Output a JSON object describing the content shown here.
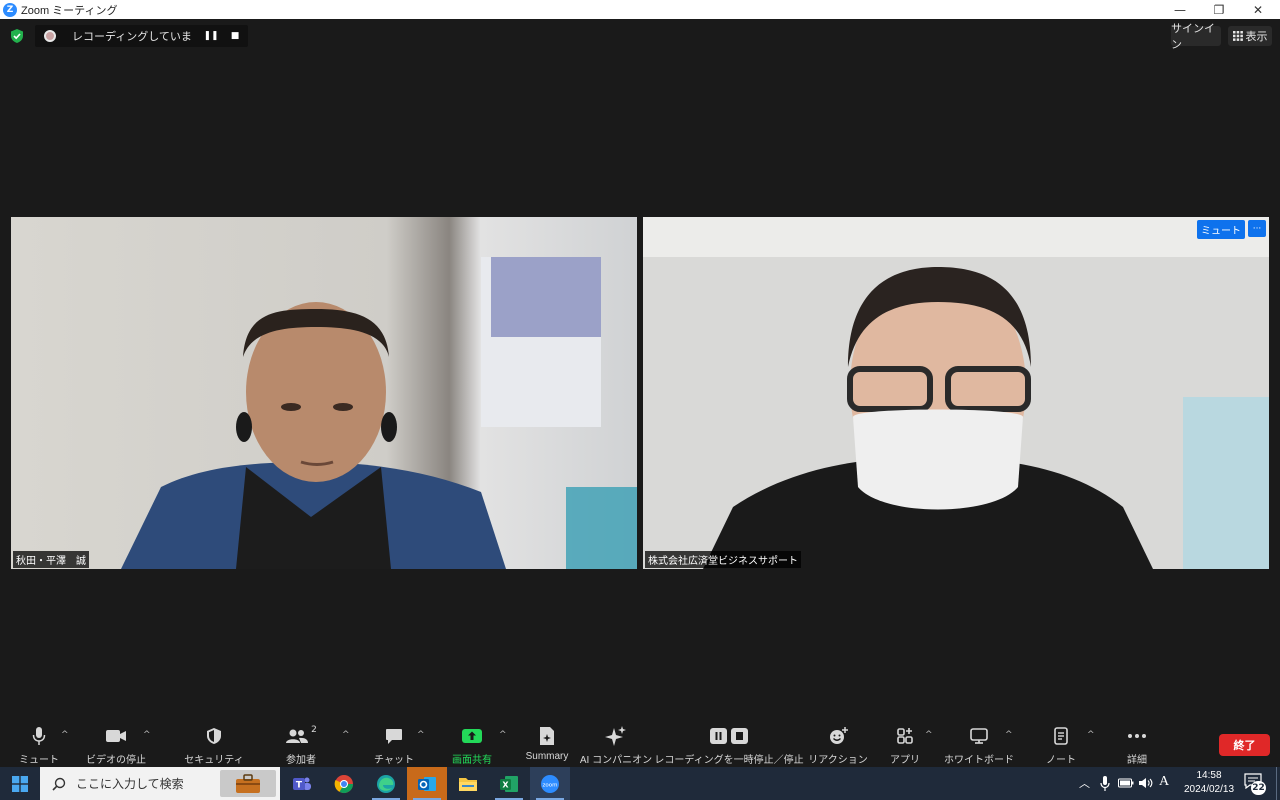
{
  "window": {
    "title": "Zoom ミーティング",
    "logo_letter": "Z",
    "controls": [
      "—",
      "❐",
      "✕"
    ]
  },
  "recording": {
    "status": "レコーディングしています...",
    "pause": "❚❚",
    "stop": "■"
  },
  "top": {
    "signin": "サインイン",
    "view": "表示"
  },
  "participants": [
    {
      "name": "秋田・平澤　誠"
    },
    {
      "name": "株式会社広済堂ビジネスサポート",
      "mute_label": "ミュート",
      "more": "···"
    }
  ],
  "toolbar": {
    "mute": "ミュート",
    "video": "ビデオの停止",
    "security": "セキュリティ",
    "participants": "参加者",
    "participants_count": "2",
    "chat": "チャット",
    "share": "画面共有",
    "summary": "Summary",
    "ai": "AI コンパニオン",
    "record": "レコーディングを一時停止／停止",
    "reactions": "リアクション",
    "apps": "アプリ",
    "whiteboard": "ホワイトボード",
    "notes": "ノート",
    "more": "詳細",
    "end": "終了",
    "caret": "^"
  },
  "taskbar": {
    "search_placeholder": "ここに入力して検索",
    "time": "14:58",
    "date": "2024/02/13",
    "ime": "A",
    "notifications": "22",
    "zoom_app": "zoom",
    "excel_letter": "X"
  },
  "colors": {
    "background": "#1a1a1a",
    "accent_blue": "#0e72ed",
    "share_green": "#23d959",
    "end_red": "#e02828",
    "shield_green": "#23b14d"
  }
}
